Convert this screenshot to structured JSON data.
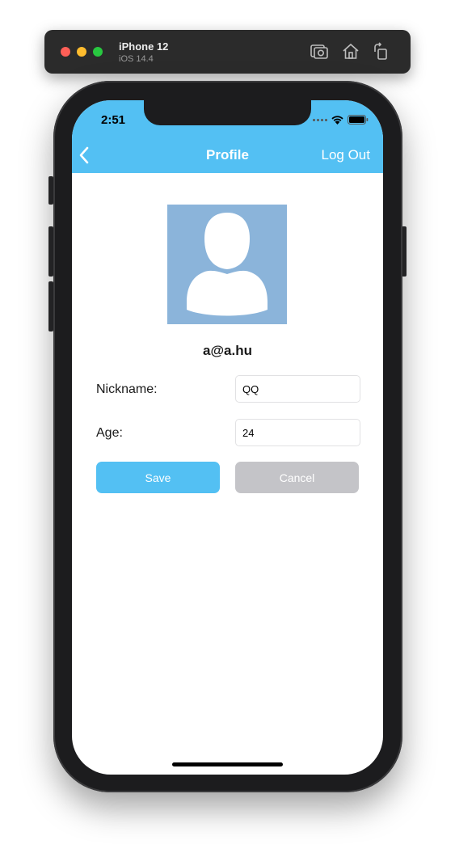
{
  "simulator": {
    "device_name": "iPhone 12",
    "os_version": "iOS 14.4",
    "toolbar_icons": [
      "screenshot-icon",
      "home-icon",
      "rotate-icon"
    ]
  },
  "status_bar": {
    "time": "2:51",
    "icons": [
      "cellular-dots-icon",
      "wifi-icon",
      "battery-icon"
    ]
  },
  "nav_bar": {
    "back_icon": "chevron-left-icon",
    "title": "Profile",
    "logout_label": "Log Out"
  },
  "profile": {
    "avatar_icon": "person-silhouette-icon",
    "email": "a@a.hu",
    "nickname_label": "Nickname:",
    "nickname_value": "QQ",
    "age_label": "Age:",
    "age_value": "24"
  },
  "actions": {
    "save_label": "Save",
    "cancel_label": "Cancel"
  },
  "colors": {
    "nav_background": "#53c0f3",
    "save_button": "#53c0f3",
    "cancel_button": "#c4c4c8",
    "avatar_background": "#8bb4da",
    "phone_frame": "#1c1c1e"
  }
}
